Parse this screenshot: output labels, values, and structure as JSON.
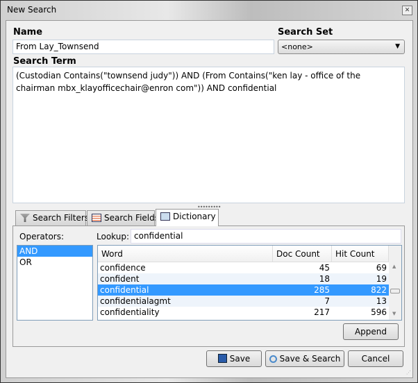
{
  "window": {
    "title": "New Search",
    "close_icon": "close-icon"
  },
  "name": {
    "label": "Name",
    "value": "From Lay_Townsend"
  },
  "search_set": {
    "label": "Search Set",
    "value": "<none>"
  },
  "search_term": {
    "label": "Search Term",
    "value": "(Custodian Contains(\"townsend judy\")) AND (From Contains(\"ken lay - office of the chairman mbx_klayofficechair@enron com\")) AND confidential"
  },
  "tabs": [
    {
      "label": "Search Filters",
      "icon": "funnel-icon"
    },
    {
      "label": "Search Fields",
      "icon": "fields-icon"
    },
    {
      "label": "Dictionary",
      "icon": "book-icon",
      "selected": true
    }
  ],
  "dictionary": {
    "operators_label": "Operators:",
    "operators": [
      "AND",
      "OR"
    ],
    "selected_operator": "AND",
    "lookup_label": "Lookup:",
    "lookup_value": "confidential",
    "columns": [
      "Word",
      "Doc Count",
      "Hit Count"
    ],
    "rows": [
      [
        "confidence",
        "45",
        "69"
      ],
      [
        "confident",
        "18",
        "19"
      ],
      [
        "confidential",
        "285",
        "822"
      ],
      [
        "confidentialagmt",
        "7",
        "13"
      ],
      [
        "confidentiality",
        "217",
        "596"
      ]
    ],
    "selected_row": 2,
    "append_label": "Append"
  },
  "buttons": {
    "save": "Save",
    "save_search": "Save & Search",
    "cancel": "Cancel"
  },
  "colors": {
    "selection": "#3399ff"
  }
}
